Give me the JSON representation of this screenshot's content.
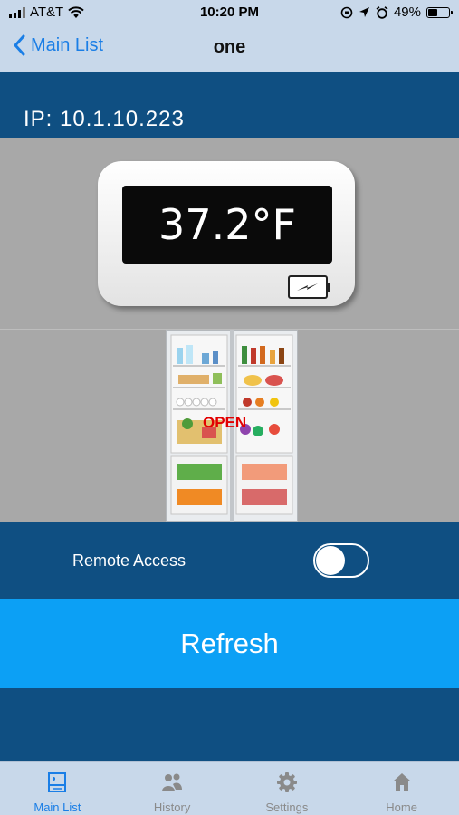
{
  "status_bar": {
    "carrier": "AT&T",
    "time": "10:20 PM",
    "battery": "49%",
    "battery_level": 0.49
  },
  "nav": {
    "back_label": "Main List",
    "title": "one"
  },
  "device": {
    "ip_text": "IP: 10.1.10.223",
    "temperature": "37.2°F",
    "door_status": "OPEN"
  },
  "remote": {
    "label": "Remote Access",
    "enabled": false
  },
  "refresh_label": "Refresh",
  "tabs": [
    {
      "label": "Main List",
      "icon": "main-list-icon",
      "active": true
    },
    {
      "label": "History",
      "icon": "people-icon",
      "active": false
    },
    {
      "label": "Settings",
      "icon": "gear-icon",
      "active": false
    },
    {
      "label": "Home",
      "icon": "home-icon",
      "active": false
    }
  ],
  "colors": {
    "accent": "#1a7ee6",
    "navy": "#0f4f82",
    "refresh": "#0ca0f5",
    "bars": "#c8d8ea",
    "door_open": "#e20000"
  }
}
